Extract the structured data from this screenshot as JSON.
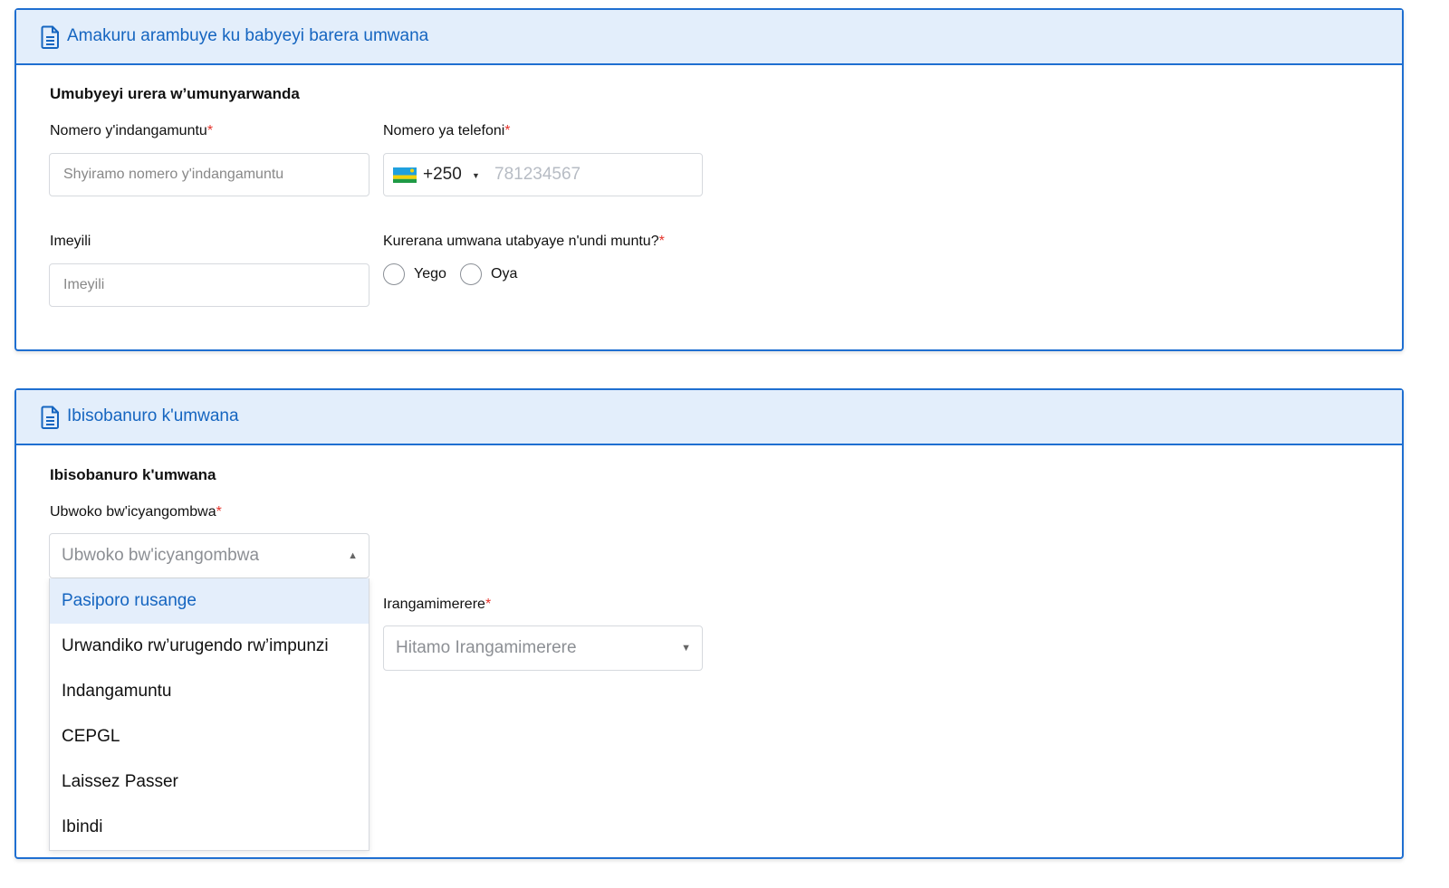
{
  "section1": {
    "header_title": "Amakuru arambuye ku babyeyi barera umwana",
    "subtitle": "Umubyeyi urera w’umunyarwanda",
    "id_number": {
      "label": "Nomero y'indangamuntu",
      "placeholder": "Shyiramo nomero y'indangamuntu"
    },
    "phone": {
      "label": "Nomero ya telefoni",
      "country_code": "+250",
      "placeholder": "781234567"
    },
    "email": {
      "label": "Imeyili",
      "placeholder": "Imeyili"
    },
    "coparent": {
      "question": "Kurerana umwana utabyaye n'undi muntu?",
      "options": [
        "Yego",
        "Oya"
      ]
    }
  },
  "section2": {
    "header_title": "Ibisobanuro k'umwana",
    "subtitle": "Ibisobanuro k'umwana",
    "doc_type": {
      "label": "Ubwoko bw'icyangombwa",
      "placeholder": "Ubwoko bw'icyangombwa",
      "options": [
        "Pasiporo rusange",
        "Urwandiko rw’urugendo rw’impunzi",
        "Indangamuntu",
        "CEPGL",
        "Laissez Passer",
        "Ibindi"
      ]
    },
    "nationality": {
      "label": "Irangamimerere",
      "placeholder": "Hitamo Irangamimerere"
    }
  },
  "required_mark": "*",
  "colors": {
    "accent": "#1f6fd1",
    "header_bg": "#e3eefb",
    "required": "#e5342c",
    "highlight_bg": "#e4eefb"
  },
  "icons": [
    "document-icon",
    "rwanda-flag-icon",
    "chevron-down-icon",
    "chevron-up-icon"
  ]
}
